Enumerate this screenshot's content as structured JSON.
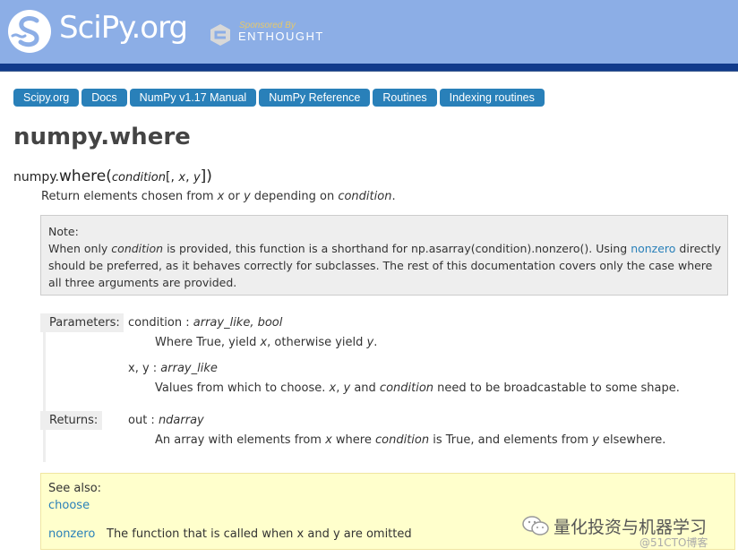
{
  "header": {
    "logo_text": "SciPy.org",
    "sponsored_label": "Sponsored By",
    "sponsor_name": "ENTHOUGHT",
    "bg_color": "#8caee6",
    "bar_color": "#113b8c"
  },
  "breadcrumbs": [
    {
      "label": "Scipy.org"
    },
    {
      "label": "Docs"
    },
    {
      "label": "NumPy v1.17 Manual"
    },
    {
      "label": "NumPy Reference"
    },
    {
      "label": "Routines"
    },
    {
      "label": "Indexing routines"
    }
  ],
  "page": {
    "title": "numpy.where",
    "signature": {
      "module": "numpy.",
      "func": "where",
      "open": "(",
      "arg": "condition",
      "optional_open": "[, ",
      "x": "x",
      "sep": ", ",
      "y": "y",
      "close": "])"
    },
    "summary": {
      "t1": "Return elements chosen from ",
      "x": "x",
      "t2": " or ",
      "y": "y",
      "t3": " depending on ",
      "cond": "condition",
      "t4": "."
    }
  },
  "note": {
    "title": "Note:",
    "t1": "When only ",
    "cond": "condition",
    "t2": " is provided, this function is a shorthand for  np.asarray(condition).nonzero(). Using ",
    "link": "nonzero",
    "t3": " directly should be preferred, as it behaves correctly for subclasses. The rest of this documentation covers only the case where all three arguments are provided."
  },
  "parameters": {
    "label": "Parameters:",
    "items": [
      {
        "name": "condition : ",
        "type": "array_like, bool",
        "desc": {
          "t1": "Where True, yield ",
          "x": "x",
          "t2": ", otherwise yield ",
          "y": "y",
          "t3": "."
        }
      },
      {
        "name": "x, y : ",
        "type": "array_like",
        "desc": {
          "t1": "Values from which to choose. ",
          "x": "x",
          "t2": ", ",
          "y": "y",
          "t3": " and ",
          "cond": "condition",
          "t4": " need to be broadcastable to some shape."
        }
      }
    ]
  },
  "returns": {
    "label": "Returns:",
    "name": "out : ",
    "type": "ndarray",
    "desc": {
      "t1": "An array with elements from ",
      "x": "x",
      "t2": " where ",
      "cond": "condition",
      "t3": " is True, and elements from ",
      "y": "y",
      "t4": " elsewhere."
    }
  },
  "see_also": {
    "title": "See also:",
    "items": [
      {
        "link": "choose",
        "desc": ""
      },
      {
        "link": "nonzero",
        "desc": "The function that is called when x and y are omitted"
      }
    ]
  },
  "watermark": {
    "text": "量化投资与机器学习",
    "sub": "@51CTO博客"
  },
  "colors": {
    "link": "#2980b9",
    "breadcrumb_bg": "#2980b9",
    "note_bg": "#eeeeee",
    "seealso_bg": "#ffffcc"
  }
}
